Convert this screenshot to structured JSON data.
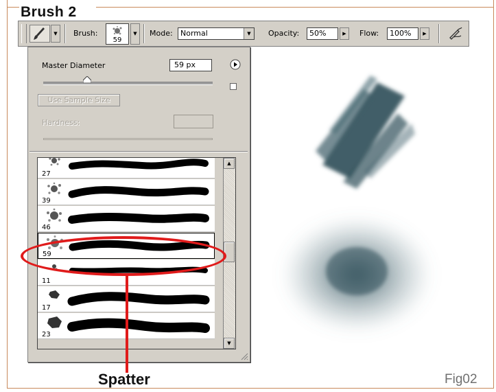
{
  "figure": {
    "title": "Brush 2",
    "fig_label": "Fig02",
    "callout": "Spatter"
  },
  "toolbar": {
    "brush_label": "Brush:",
    "brush_size": "59",
    "mode_label": "Mode:",
    "mode_value": "Normal",
    "opacity_label": "Opacity:",
    "opacity_value": "50%",
    "flow_label": "Flow:",
    "flow_value": "100%",
    "icons": [
      "brush-tool-icon",
      "airbrush-icon"
    ]
  },
  "panel": {
    "master_diameter_label": "Master Diameter",
    "master_diameter_value": "59 px",
    "master_diameter_fraction": 0.26,
    "use_sample_size_label": "Use Sample Size",
    "hardness_label": "Hardness:",
    "brushes": [
      {
        "size": "27",
        "selected": false
      },
      {
        "size": "39",
        "selected": false
      },
      {
        "size": "46",
        "selected": false
      },
      {
        "size": "59",
        "selected": true
      },
      {
        "size": "11",
        "selected": false
      },
      {
        "size": "17",
        "selected": false
      },
      {
        "size": "23",
        "selected": false
      }
    ]
  },
  "colors": {
    "accent": "#e01b1b",
    "stroke": "#2e4e58",
    "panel": "#d4d0c8",
    "frame": "#c8895a"
  }
}
